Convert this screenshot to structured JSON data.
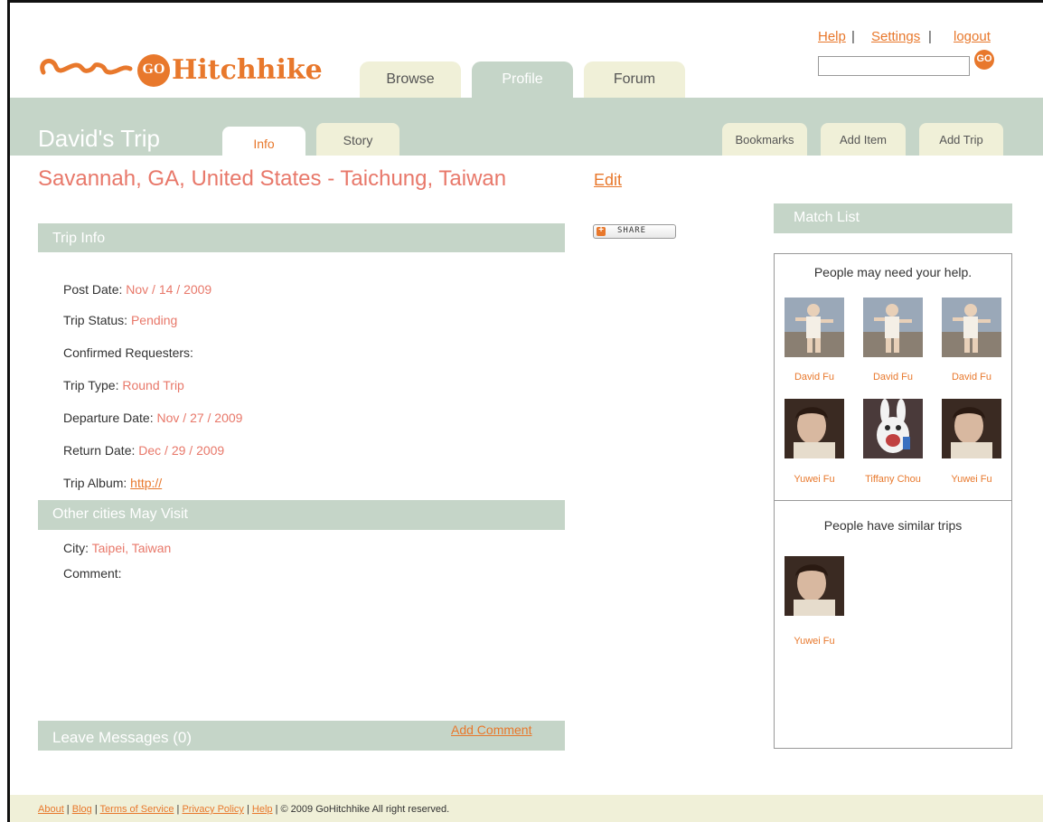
{
  "logo": {
    "text": "Hitchhike",
    "go": "GO"
  },
  "nav": {
    "tabs": [
      {
        "label": "Browse",
        "active": false
      },
      {
        "label": "Profile",
        "active": true
      },
      {
        "label": "Forum",
        "active": false
      }
    ],
    "top_links": {
      "help": "Help",
      "settings": "Settings",
      "logout": "logout"
    },
    "search": {
      "placeholder": "",
      "go_label": "GO"
    }
  },
  "trip": {
    "title": "David's Trip",
    "subtabs": [
      {
        "label": "Info",
        "active": true
      },
      {
        "label": "Story",
        "active": false
      }
    ],
    "actions": {
      "bookmarks": "Bookmarks",
      "add_item": "Add Item",
      "add_trip": "Add Trip"
    },
    "route": "Savannah, GA, United States - Taichung, Taiwan",
    "edit_label": "Edit",
    "share_label": "SHARE"
  },
  "trip_info": {
    "header": "Trip Info",
    "fields": {
      "post_date": {
        "label": "Post Date: ",
        "value": "Nov / 14 / 2009"
      },
      "trip_status": {
        "label": "Trip Status: ",
        "value": "Pending"
      },
      "confirmed_requesters": {
        "label": "Confirmed Requesters:",
        "value": ""
      },
      "trip_type": {
        "label": "Trip Type: ",
        "value": "Round Trip"
      },
      "departure_date": {
        "label": "Departure Date: ",
        "value": "Nov / 27 / 2009"
      },
      "return_date": {
        "label": "Return Date: ",
        "value": "Dec / 29 / 2009"
      },
      "trip_album": {
        "label": "Trip Album: ",
        "value": "http://"
      }
    }
  },
  "other_cities": {
    "header": "Other cities May Visit",
    "city_label": "City: ",
    "city_value": "Taipei, Taiwan",
    "comment_label": "Comment:"
  },
  "messages": {
    "header": "Leave Messages (0)",
    "add_comment": "Add Comment"
  },
  "match_list": {
    "header": "Match List",
    "need_help": {
      "title": "People may need your help.",
      "people": [
        "David Fu",
        "David Fu",
        "David Fu",
        "Yuwei Fu",
        "Tiffany Chou",
        "Yuwei Fu"
      ]
    },
    "similar": {
      "title": "People have similar trips",
      "people": [
        "Yuwei Fu"
      ]
    }
  },
  "footer": {
    "about": "About",
    "blog": "Blog",
    "tos": "Terms of Service",
    "privacy": "Privacy Policy",
    "help": "Help",
    "copyright": "© 2009 GoHitchhike All right reserved."
  },
  "colors": {
    "accent": "#e8782c",
    "bar": "#c5d5c8",
    "tab": "#f0f0d8"
  }
}
